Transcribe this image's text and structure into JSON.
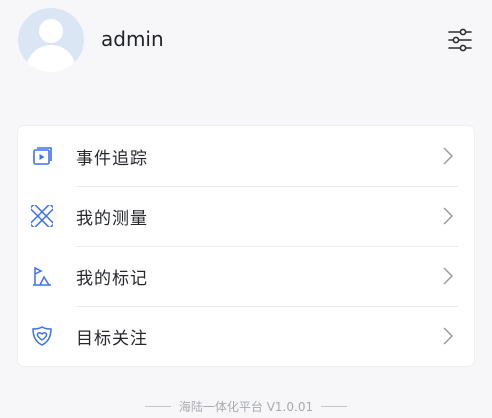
{
  "header": {
    "username": "admin",
    "avatar_icon": "user-avatar-icon",
    "settings_icon": "sliders-icon"
  },
  "menu": {
    "items": [
      {
        "label": "事件追踪",
        "icon": "play-square-icon"
      },
      {
        "label": "我的测量",
        "icon": "ruler-cross-icon"
      },
      {
        "label": "我的标记",
        "icon": "marker-flag-icon"
      },
      {
        "label": "目标关注",
        "icon": "heart-shield-icon"
      }
    ]
  },
  "footer": {
    "text": "海陆一体化平台 V1.0.01"
  },
  "colors": {
    "accent": "#3d72ec",
    "avatar_bg": "#dbe6f4",
    "text": "#26282c",
    "muted": "#a9abb0"
  }
}
